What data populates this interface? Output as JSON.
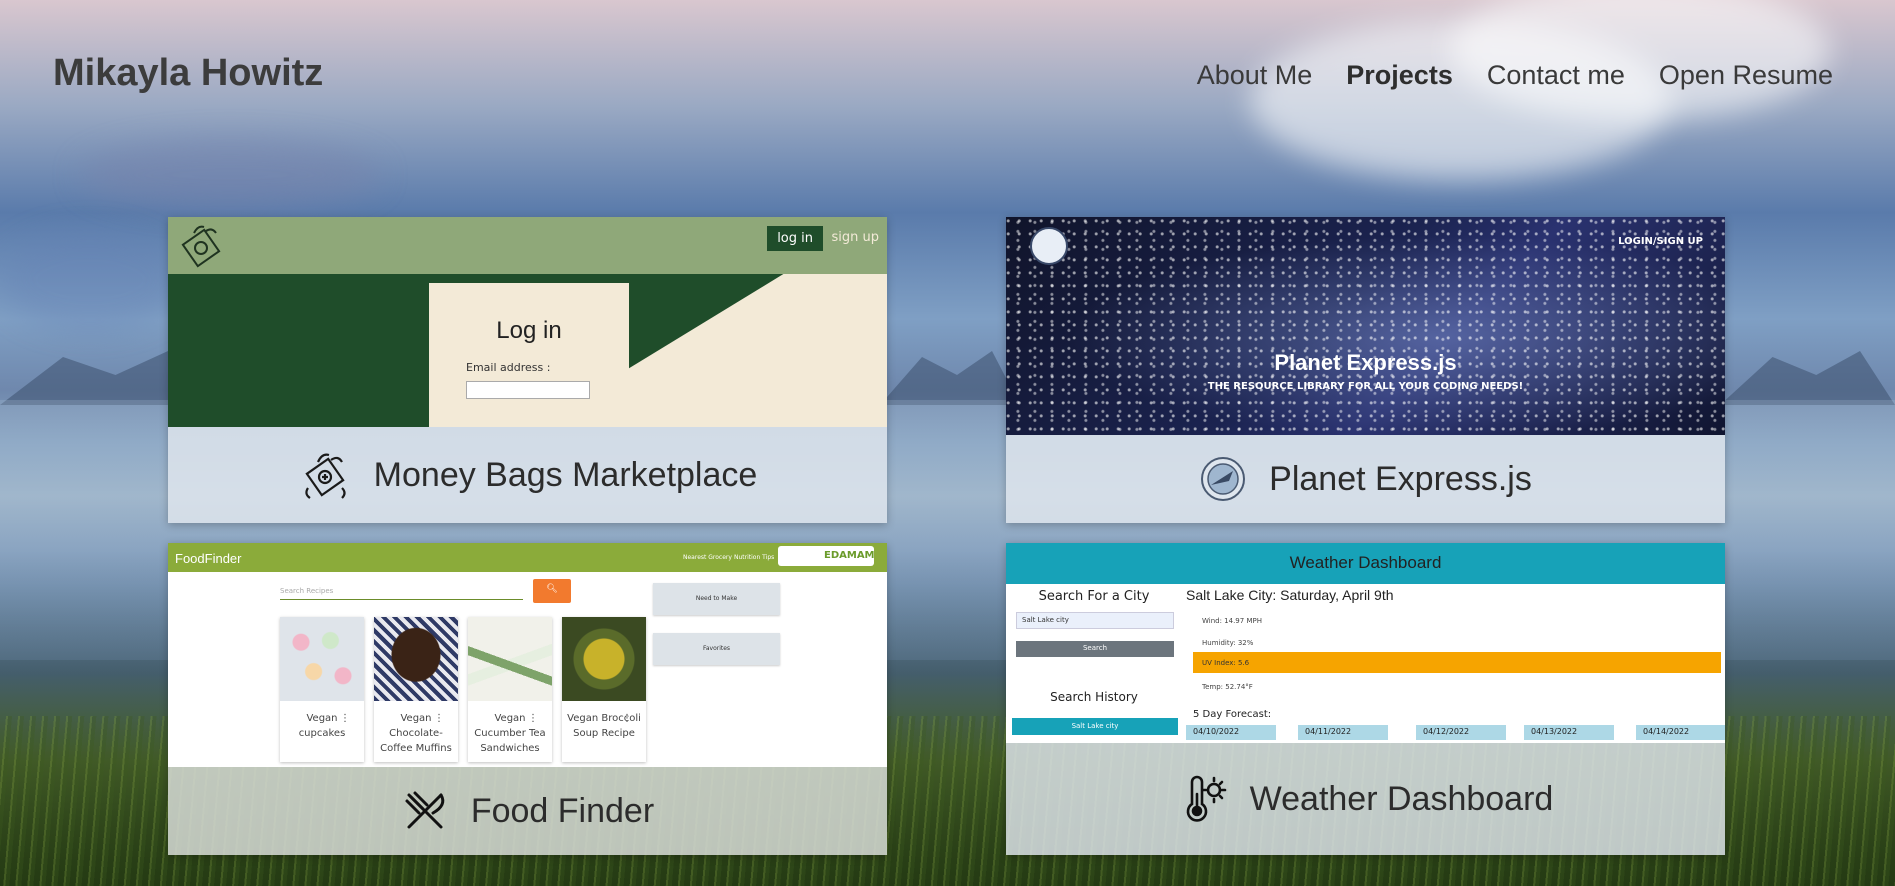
{
  "brand": {
    "name": "Mikayla Howitz"
  },
  "nav": {
    "items": [
      {
        "label": "About Me",
        "active": false
      },
      {
        "label": "Projects",
        "active": true
      },
      {
        "label": "Contact me",
        "active": false
      },
      {
        "label": "Open Resume",
        "active": false
      }
    ]
  },
  "projects": [
    {
      "title": "Money Bags Marketplace",
      "icon": "money-bag-icon",
      "preview": {
        "login_btn": "log in",
        "signup_link": "sign up",
        "form_title": "Log in",
        "email_label": "Email address :"
      }
    },
    {
      "title": "Planet Express.js",
      "icon": "planet-express-logo",
      "preview": {
        "login_link": "LOGIN/SIGN UP",
        "hero_title": "Planet Express.js",
        "hero_subtitle": "THE RESOURCE LIBRARY FOR ALL YOUR CODING NEEDS!"
      }
    },
    {
      "title": "Food Finder",
      "icon": "fork-knife-icon",
      "preview": {
        "brand": "FoodFinder",
        "nav_link_1": "Nearest Grocery",
        "nav_link_2": "Nutrition Tips",
        "edamam_label": "EDAMAM",
        "search_placeholder": "Search Recipes",
        "side_btn_1": "Need to Make",
        "side_btn_2": "Favorites",
        "recipes": [
          {
            "name": "Vegan cupcakes"
          },
          {
            "name": "Vegan Chocolate-Coffee Muffins"
          },
          {
            "name": "Vegan Cucumber Tea Sandwiches"
          },
          {
            "name": "Vegan Broccoli Soup Recipe"
          }
        ]
      }
    },
    {
      "title": "Weather Dashboard",
      "icon": "thermometer-sun-icon",
      "preview": {
        "header": "Weather Dashboard",
        "search_heading": "Search For a City",
        "search_value": "Salt Lake city",
        "search_btn": "Search",
        "history_heading": "Search History",
        "history_item": "Salt Lake city",
        "city_date": "Salt Lake City: Saturday, April 9th",
        "wind": "Wind: 14.97 MPH",
        "humidity": "Humidity: 32%",
        "uv": "UV Index: 5.6",
        "temp": "Temp: 52.74°F",
        "forecast_label": "5 Day Forecast:",
        "dates": [
          "04/10/2022",
          "04/11/2022",
          "04/12/2022",
          "04/13/2022",
          "04/14/2022"
        ]
      }
    }
  ]
}
